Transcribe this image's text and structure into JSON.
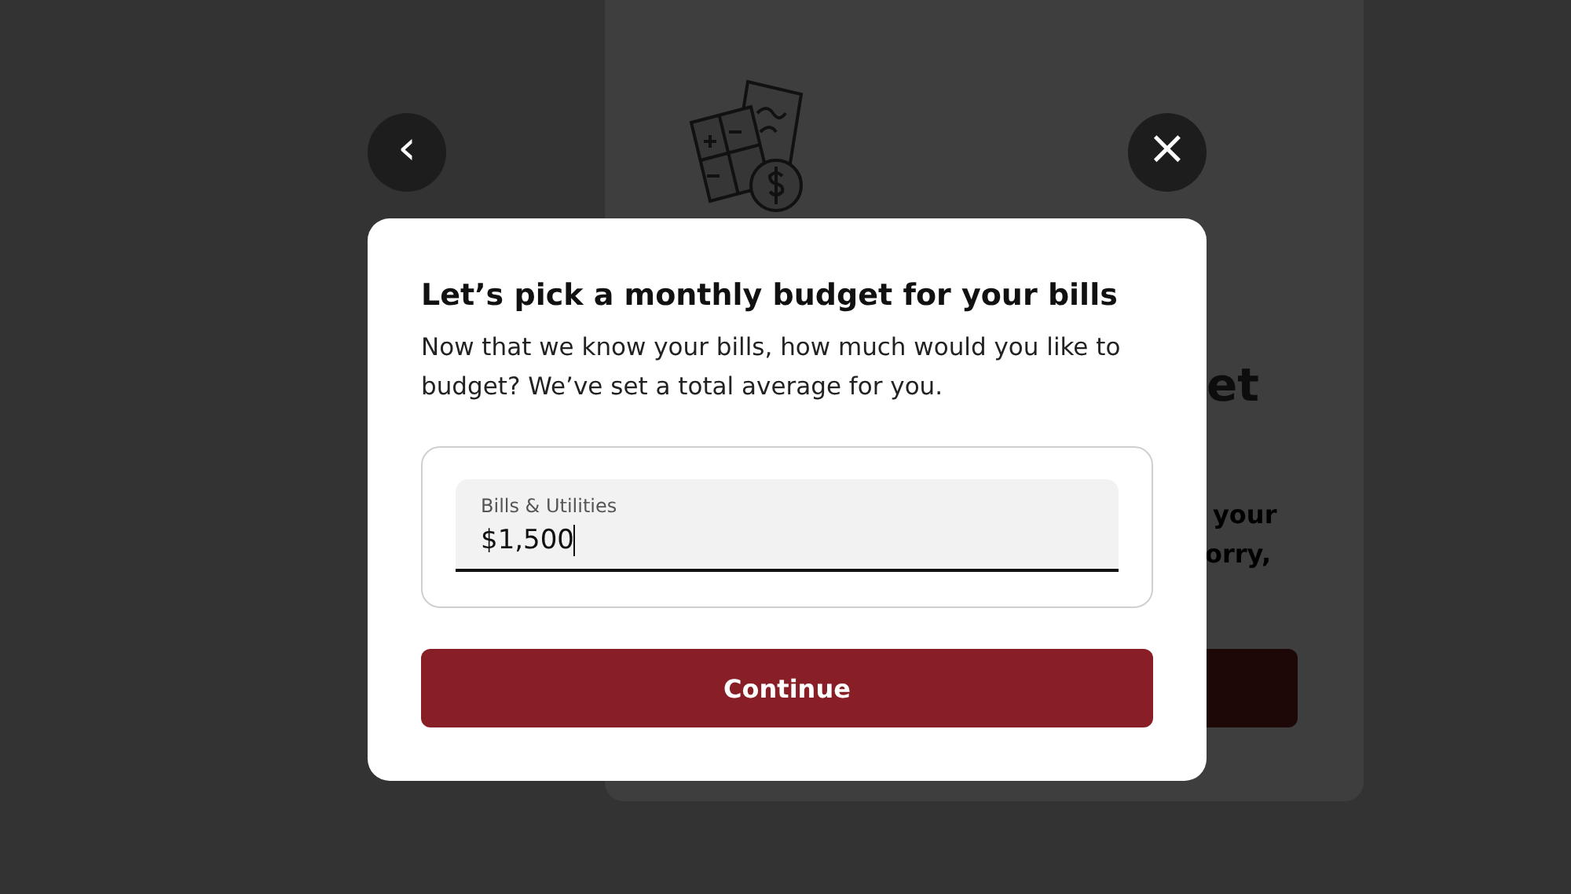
{
  "background_card": {
    "heading_fragment": "et",
    "body_fragments": [
      "your",
      "orry,"
    ]
  },
  "nav": {
    "back_label": "‹",
    "close_label": "×"
  },
  "dialog": {
    "title": "Let’s pick a monthly budget for your bills",
    "description": "Now that we know your bills, how much would you like to budget? We’ve set a total average for you.",
    "field": {
      "label": "Bills & Utilities",
      "value": "$1,500",
      "focused": true
    },
    "continue_button": "Continue"
  }
}
